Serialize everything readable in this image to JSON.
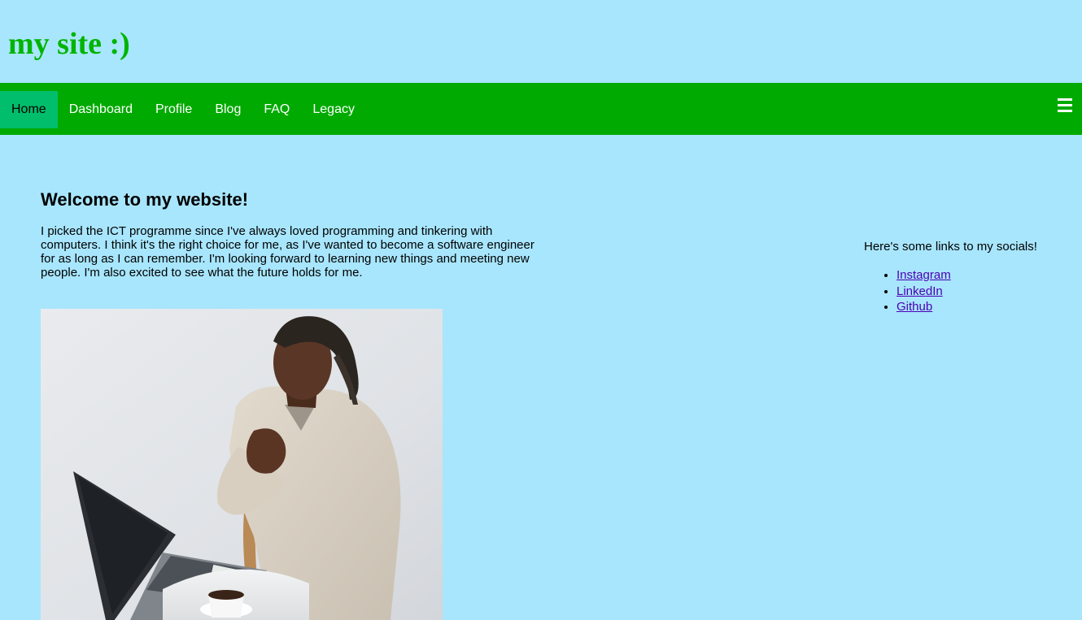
{
  "header": {
    "site_title": "my site :)"
  },
  "nav": {
    "items": [
      {
        "label": "Home",
        "active": true
      },
      {
        "label": "Dashboard"
      },
      {
        "label": "Profile"
      },
      {
        "label": "Blog"
      },
      {
        "label": "FAQ"
      },
      {
        "label": "Legacy"
      }
    ],
    "menu_icon": "hamburger-menu-icon"
  },
  "main": {
    "heading": "Welcome to my website!",
    "intro": "I picked the ICT programme since I've always loved programming and tinkering with computers. I think it's the right choice for me, as I've wanted to become a software engineer for as long as I can remember. I'm looking forward to learning new things and meeting new people. I'm also excited to see what the future holds for me."
  },
  "sidebar": {
    "text": "Here's some links to my socials!",
    "links": [
      "Instagram",
      "LinkedIn",
      "Github"
    ]
  },
  "colors": {
    "page_background": "#a8e6fd",
    "title_green": "#00b400",
    "nav_green": "#00aa00",
    "nav_active": "#00be6b",
    "link_purple": "#4b00b4"
  }
}
